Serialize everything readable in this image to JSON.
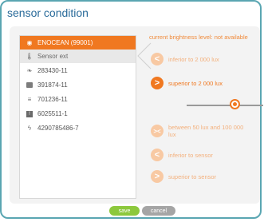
{
  "dialog": {
    "title": "sensor condition"
  },
  "sensors": [
    {
      "icon": "radio-icon",
      "label": "ENOCEAN (99001)",
      "selected": true
    },
    {
      "icon": "thermometer-icon",
      "label": "Sensor ext",
      "selected": false
    },
    {
      "icon": "leaf-icon",
      "label": "283430-11",
      "selected": false
    },
    {
      "icon": "device-icon",
      "label": "391874-11",
      "selected": false
    },
    {
      "icon": "heater-icon",
      "label": "701236-11",
      "selected": false
    },
    {
      "icon": "module-icon",
      "label": "6025511-1",
      "selected": false
    },
    {
      "icon": "bolt-icon",
      "label": "4290785486-7",
      "selected": false
    }
  ],
  "brightness_text": "current brightness level: not available",
  "conditions": [
    {
      "symbol": "<",
      "label": "inferior to 2 000 lux",
      "active": false
    },
    {
      "symbol": ">",
      "label": "superior to 2 000 lux",
      "active": true
    },
    {
      "symbol": "><",
      "label": "between 50 lux and 100 000 lux",
      "active": false
    },
    {
      "symbol": "<",
      "label": "inferior to sensor",
      "active": false
    },
    {
      "symbol": ">",
      "label": "superior to sensor",
      "active": false
    }
  ],
  "slider": {
    "value_fraction": 0.56
  },
  "buttons": {
    "save": "save",
    "cancel": "cancel"
  },
  "colors": {
    "accent": "#f07820",
    "title": "#2a6b9a",
    "save": "#8cc83c",
    "border": "#5aa6b2"
  }
}
